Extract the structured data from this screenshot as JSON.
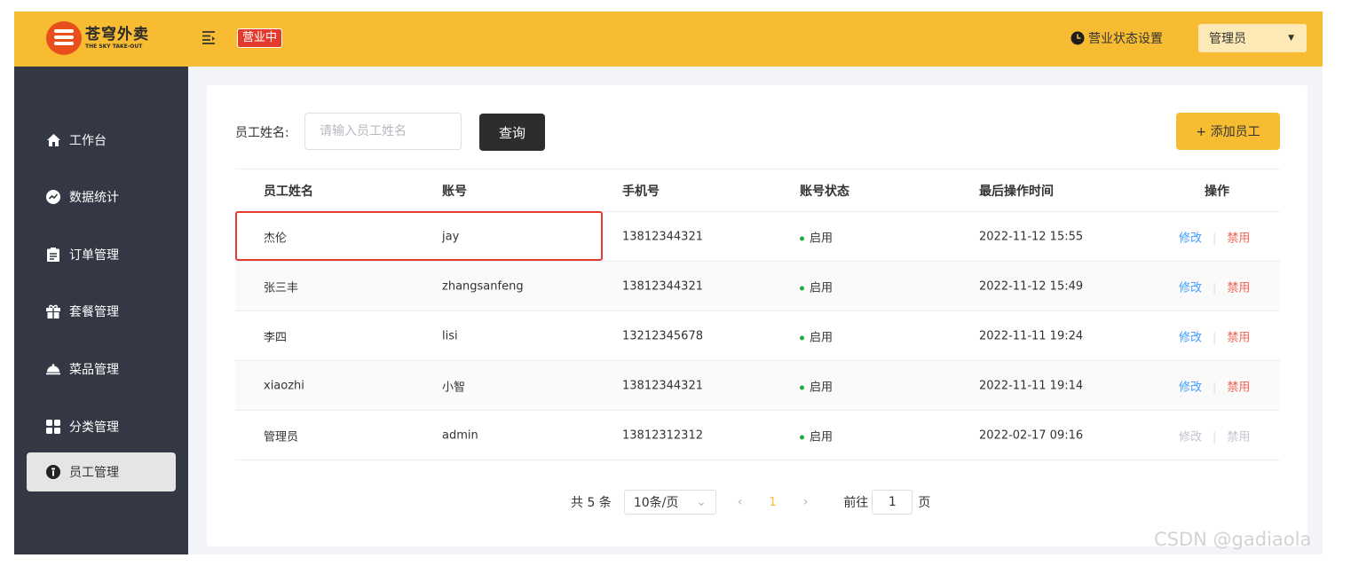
{
  "header": {
    "logo_cn": "苍穹外卖",
    "logo_en": "THE SKY TAKE-OUT",
    "status_badge": "营业中",
    "status_settings_label": "营业状态设置",
    "user": "管理员"
  },
  "sidebar": {
    "items": [
      {
        "label": "工作台",
        "icon": "home-icon"
      },
      {
        "label": "数据统计",
        "icon": "chart-icon"
      },
      {
        "label": "订单管理",
        "icon": "order-icon"
      },
      {
        "label": "套餐管理",
        "icon": "gift-icon"
      },
      {
        "label": "菜品管理",
        "icon": "dish-icon"
      },
      {
        "label": "分类管理",
        "icon": "grid-icon"
      },
      {
        "label": "员工管理",
        "icon": "employee-icon",
        "active": true
      }
    ]
  },
  "search": {
    "label": "员工姓名:",
    "placeholder": "请输入员工姓名",
    "query_label": "查询",
    "add_label": "+ 添加员工"
  },
  "table": {
    "columns": [
      "员工姓名",
      "账号",
      "手机号",
      "账号状态",
      "最后操作时间",
      "操作"
    ],
    "rows": [
      {
        "name": "杰伦",
        "account": "jay",
        "phone": "13812344321",
        "status": "启用",
        "time": "2022-11-12 15:55",
        "edit": "修改",
        "disable": "禁用"
      },
      {
        "name": "张三丰",
        "account": "zhangsanfeng",
        "phone": "13812344321",
        "status": "启用",
        "time": "2022-11-12 15:49",
        "edit": "修改",
        "disable": "禁用"
      },
      {
        "name": "李四",
        "account": "lisi",
        "phone": "13212345678",
        "status": "启用",
        "time": "2022-11-11 19:24",
        "edit": "修改",
        "disable": "禁用"
      },
      {
        "name": "xiaozhi",
        "account": "小智",
        "phone": "13812344321",
        "status": "启用",
        "time": "2022-11-11 19:14",
        "edit": "修改",
        "disable": "禁用"
      },
      {
        "name": "管理员",
        "account": "admin",
        "phone": "13812312312",
        "status": "启用",
        "time": "2022-02-17 09:16",
        "edit": "修改",
        "disable": "禁用"
      }
    ]
  },
  "pager": {
    "total": "共 5 条",
    "page_size": "10条/页",
    "prev": "‹",
    "current": "1",
    "next": "›",
    "goto_prefix": "前往",
    "goto_value": "1",
    "goto_suffix": "页"
  },
  "watermark": "CSDN @gadiaola",
  "colors": {
    "brand": "#f7bc32",
    "sidebar": "#343744",
    "badge": "#e43c2c",
    "highlight": "#e53a30"
  }
}
